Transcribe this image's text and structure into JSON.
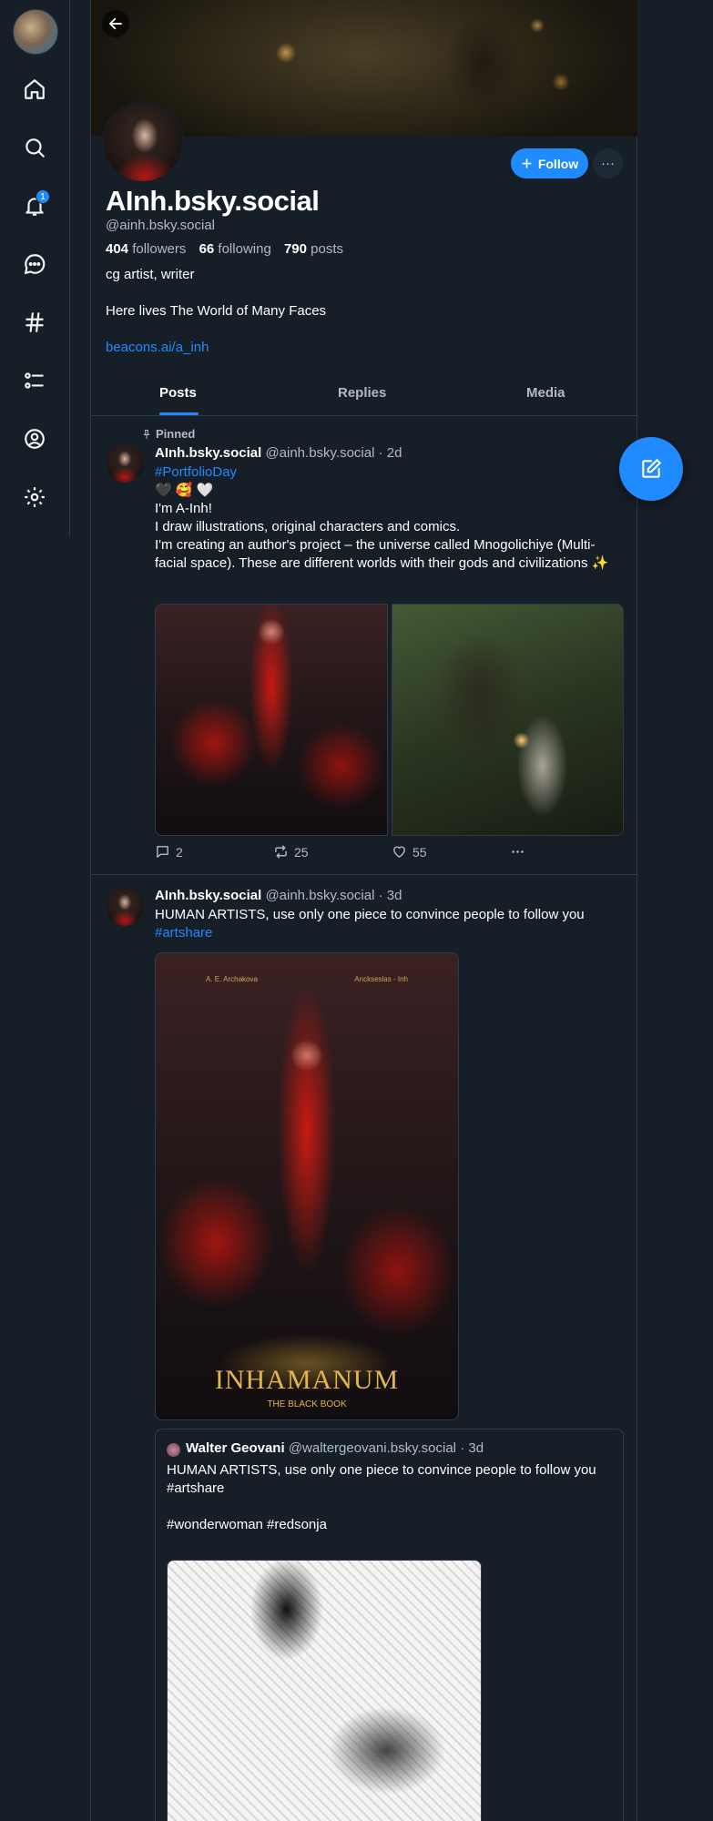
{
  "nav": {
    "notifications_badge": "1",
    "items": [
      "home-icon",
      "search-icon",
      "bell-icon",
      "chat-icon",
      "hashtag-icon",
      "list-icon",
      "profile-icon",
      "gear-icon"
    ]
  },
  "profile": {
    "display_name": "AInh.bsky.social",
    "handle": "@ainh.bsky.social",
    "followers_count": "404",
    "followers_label": "followers",
    "following_count": "66",
    "following_label": "following",
    "posts_count": "790",
    "posts_label": "posts",
    "bio_line1": "cg artist, writer",
    "bio_line2": "Here lives The World of Many Faces",
    "bio_link": "beacons.ai/a_inh",
    "follow_label": "Follow",
    "more_label": "···"
  },
  "tabs": [
    {
      "label": "Posts"
    },
    {
      "label": "Replies"
    },
    {
      "label": "Media"
    }
  ],
  "posts": [
    {
      "pinned_label": "Pinned",
      "author": "AInh.bsky.social",
      "handle": "@ainh.bsky.social",
      "time": "· 2d",
      "hashtag": "#PortfolioDay",
      "emoji_line": "🖤 🥰 🤍",
      "line1": "I'm A-Inh!",
      "line2": "I draw illustrations, original characters and comics.",
      "line3": "I'm creating an author's project – the universe called Mnogolichiye (Multi-facial space). These are different worlds with their gods and civilizations ✨",
      "replies": "2",
      "reposts": "25",
      "likes": "55"
    },
    {
      "author": "AInh.bsky.social",
      "handle": "@ainh.bsky.social",
      "time": "· 3d",
      "text": "HUMAN ARTISTS, use only one piece to convince people to follow you",
      "hashtag": "#artshare",
      "art_top_left": "A. E. Archakova",
      "art_top_right": "Anckseslas - Inh",
      "art_title": "INHAMANUM",
      "art_subtitle": "THE BLACK BOOK",
      "quote": {
        "author": "Walter Geovani",
        "handle": "@waltergeovani.bsky.social",
        "time": "· 3d",
        "text": "HUMAN ARTISTS, use only one piece to convince people to follow you",
        "tag1": "#artshare",
        "tag2": "#wonderwoman #redsonja"
      }
    }
  ]
}
